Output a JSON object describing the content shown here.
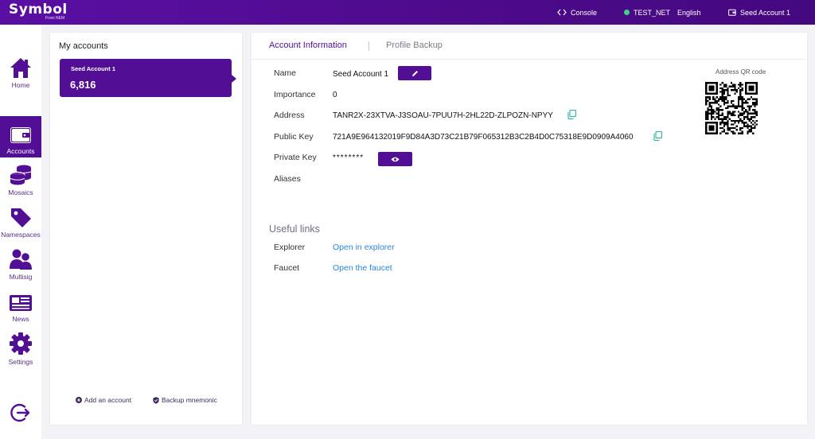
{
  "topbar": {
    "logo": "Symbol",
    "logo_sub": "From NEM",
    "console": "Console",
    "network": "TEST_NET",
    "language": "English",
    "account": "Seed Account 1"
  },
  "sidebar": {
    "items": [
      {
        "label": "Home",
        "icon": "home-icon"
      },
      {
        "label": "Accounts",
        "icon": "wallet-icon",
        "active": true
      },
      {
        "label": "Mosaics",
        "icon": "coins-icon"
      },
      {
        "label": "Namespaces",
        "icon": "tag-icon"
      },
      {
        "label": "Multisig",
        "icon": "users-icon"
      },
      {
        "label": "News",
        "icon": "newspaper-icon"
      },
      {
        "label": "Settings",
        "icon": "gear-icon"
      }
    ],
    "logout_icon": "logout-icon"
  },
  "accounts": {
    "title": "My accounts",
    "selected": {
      "name": "Seed Account 1",
      "balance": "6,816"
    },
    "add_account": "Add an account",
    "backup_mnemonic": "Backup mnemonic"
  },
  "tabs": {
    "account_info": "Account Information",
    "profile_backup": "Profile Backup"
  },
  "info": {
    "name_label": "Name",
    "name_value": "Seed Account 1",
    "importance_label": "Importance",
    "importance_value": "0",
    "address_label": "Address",
    "address_value": "TANR2X-23XTVA-J3SOAU-7PUU7H-2HL22D-ZLPOZN-NPYY",
    "public_key_label": "Public Key",
    "public_key_value": "721A9E964132019F9D84A3D73C21B79F065312B3C2B4D0C75318E9D0909A4060",
    "private_key_label": "Private Key",
    "private_key_value": "********",
    "aliases_label": "Aliases",
    "qr_label": "Address QR code"
  },
  "links": {
    "title": "Useful links",
    "explorer_label": "Explorer",
    "explorer_link": "Open in explorer",
    "faucet_label": "Faucet",
    "faucet_link": "Open the faucet"
  },
  "colors": {
    "brand": "#520f95",
    "link": "#2a86d6",
    "copy": "#2bb0a8",
    "online": "#3fd18a"
  }
}
